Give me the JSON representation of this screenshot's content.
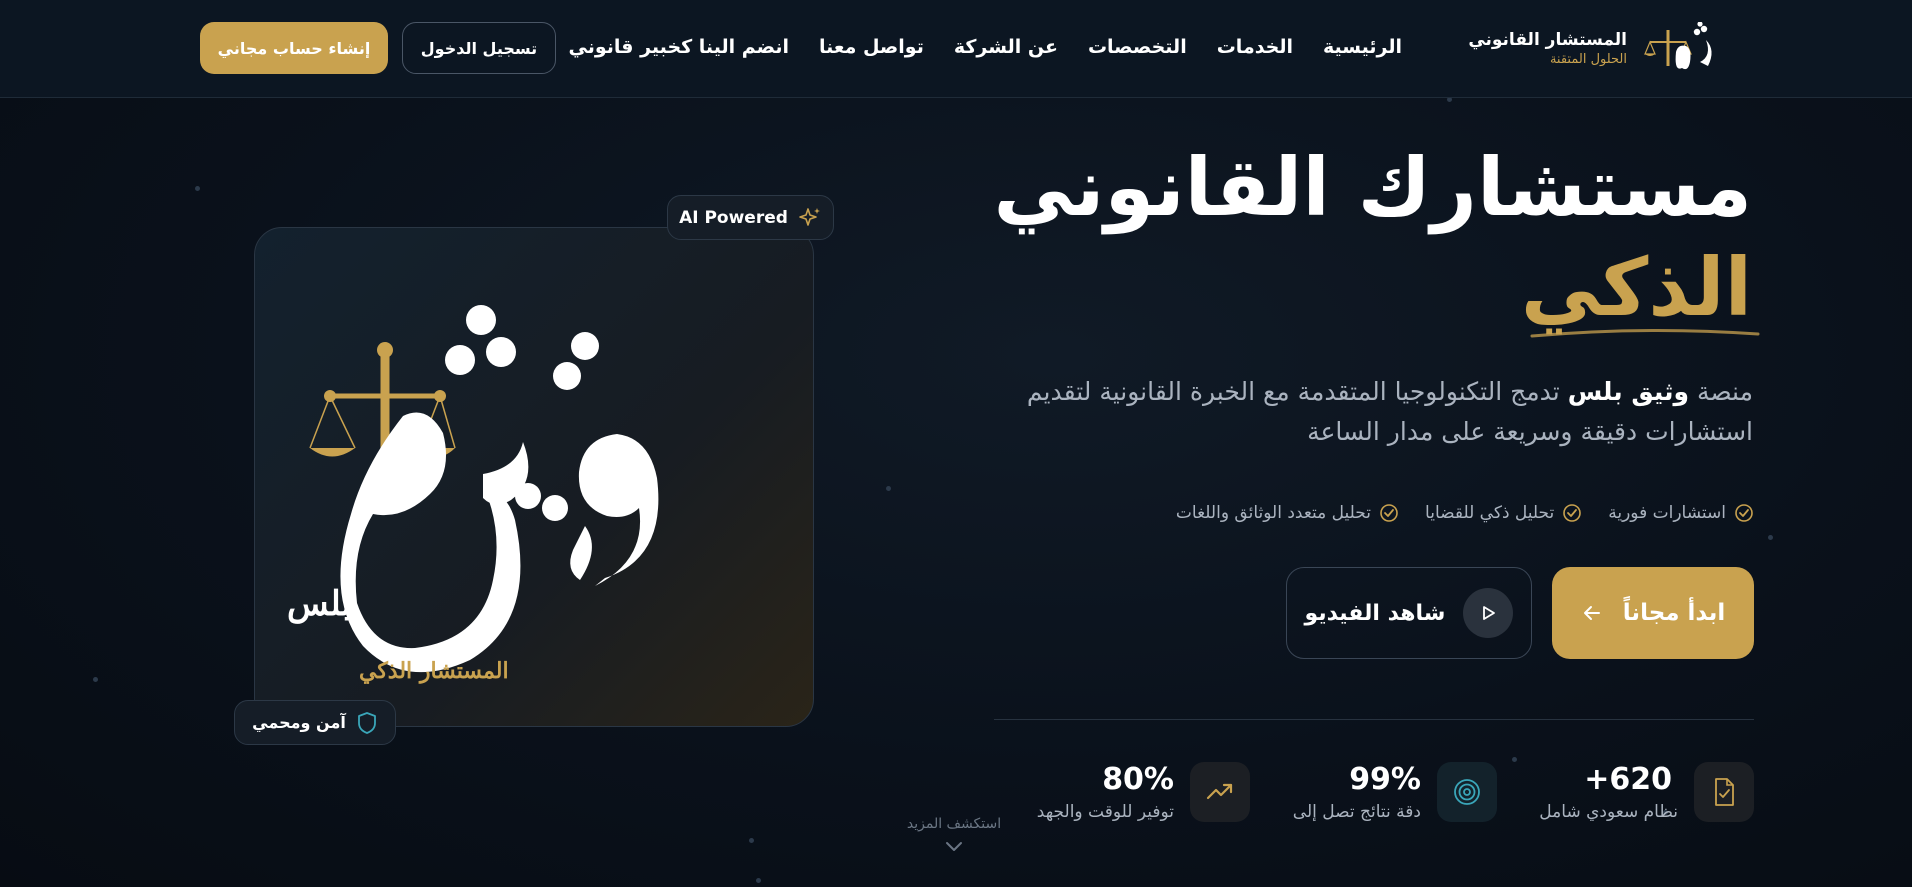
{
  "header": {
    "logo": {
      "name": "المستشار القانوني",
      "tagline": "الحلول المتقنة"
    },
    "nav": [
      {
        "label": "الرئيسية"
      },
      {
        "label": "الخدمات"
      },
      {
        "label": "التخصصات"
      },
      {
        "label": "عن الشركة"
      },
      {
        "label": "تواصل معنا"
      },
      {
        "label": "انضم الينا كخبير قانوني"
      }
    ],
    "login_label": "تسجيل الدخول",
    "signup_label": "إنشاء حساب مجاني"
  },
  "hero": {
    "title_line1": "مستشارك القانوني",
    "title_line2": "الذكي",
    "desc_prefix": "منصة ",
    "desc_brand": "وثيق بلس",
    "desc_rest": " تدمج التكنولوجيا المتقدمة مع الخبرة القانونية لتقديم استشارات دقيقة وسريعة على مدار الساعة",
    "features": [
      {
        "label": "استشارات فورية"
      },
      {
        "label": "تحليل ذكي للقضايا"
      },
      {
        "label": "تحليل متعدد الوثائق واللغات"
      }
    ],
    "start_label": "ابدأ مجاناً",
    "video_label": "شاهد الفيديو"
  },
  "card": {
    "ai_badge": "AI Powered",
    "secure_badge": "آمن ومحمي",
    "brand_main": "وثيق",
    "brand_plus": "بلس",
    "brand_sub": "المستشار الذكي"
  },
  "stats": [
    {
      "value": "+620",
      "label": "نظام سعودي شامل",
      "icon": "document-check-icon"
    },
    {
      "value": "99%",
      "label": "دقة نتائج تصل إلى",
      "icon": "target-icon"
    },
    {
      "value": "80%",
      "label": "توفير للوقت والجهد",
      "icon": "trending-up-icon"
    }
  ],
  "scroll_hint": "استكشف المزيد",
  "colors": {
    "gold": "#c9a24f",
    "bg": "#0a111b",
    "teal": "#3aa6b9"
  }
}
